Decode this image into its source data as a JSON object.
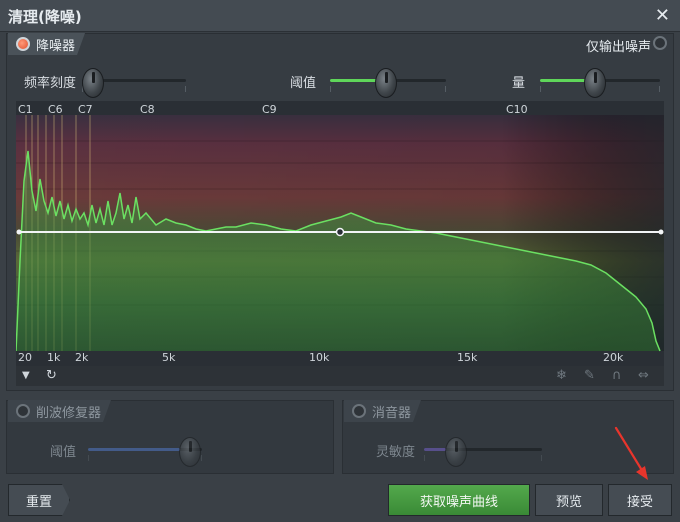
{
  "window": {
    "title": "清理(降噪)",
    "close": "✕"
  },
  "denoiser": {
    "title": "降噪器",
    "output_noise_only": "仅输出噪声",
    "knobs": {
      "freq_res": {
        "label": "频率刻度"
      },
      "threshold": {
        "label": "阈值"
      },
      "amount": {
        "label": "量"
      }
    },
    "note_labels": [
      "C1",
      "C6",
      "C7",
      "C8",
      "C9",
      "C10"
    ],
    "freq_labels": [
      "20",
      "1k",
      "2k",
      "5k",
      "10k",
      "15k",
      "20k"
    ]
  },
  "declipper": {
    "title": "削波修复器",
    "knob_label": "阈值"
  },
  "desser": {
    "title": "消音器",
    "knob_label": "灵敏度"
  },
  "buttons": {
    "reset": "重置",
    "capture": "获取噪声曲线",
    "preview": "预览",
    "accept": "接受"
  },
  "colors": {
    "accent_green": "#5fd65a",
    "led_on": "#e0502e",
    "arrow": "#e8352c"
  }
}
